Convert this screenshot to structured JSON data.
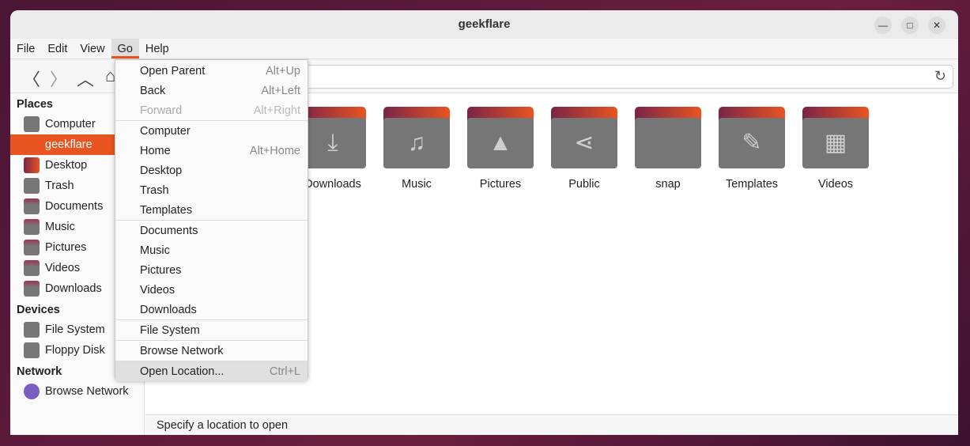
{
  "window": {
    "title": "geekflare"
  },
  "menubar": [
    "File",
    "Edit",
    "View",
    "Go",
    "Help"
  ],
  "go_menu": [
    [
      {
        "label": "Open Parent",
        "key": "Alt+Up"
      },
      {
        "label": "Back",
        "key": "Alt+Left"
      },
      {
        "label": "Forward",
        "key": "Alt+Right",
        "disabled": true
      }
    ],
    [
      {
        "label": "Computer",
        "key": ""
      },
      {
        "label": "Home",
        "key": "Alt+Home"
      },
      {
        "label": "Desktop",
        "key": ""
      },
      {
        "label": "Trash",
        "key": ""
      },
      {
        "label": "Templates",
        "key": ""
      }
    ],
    [
      {
        "label": "Documents",
        "key": ""
      },
      {
        "label": "Music",
        "key": ""
      },
      {
        "label": "Pictures",
        "key": ""
      },
      {
        "label": "Videos",
        "key": ""
      },
      {
        "label": "Downloads",
        "key": ""
      }
    ],
    [
      {
        "label": "File System",
        "key": ""
      }
    ],
    [
      {
        "label": "Browse Network",
        "key": ""
      }
    ],
    [
      {
        "label": "Open Location...",
        "key": "Ctrl+L",
        "highlighted": true
      }
    ]
  ],
  "sidebar": [
    {
      "header": "Places",
      "items": [
        {
          "label": "Computer",
          "icon": "computer"
        },
        {
          "label": "geekflare",
          "icon": "home",
          "selected": true
        },
        {
          "label": "Desktop",
          "icon": "desktop"
        },
        {
          "label": "Trash",
          "icon": "trash"
        },
        {
          "label": "Documents",
          "icon": "folder-documents"
        },
        {
          "label": "Music",
          "icon": "folder-music"
        },
        {
          "label": "Pictures",
          "icon": "folder-pictures"
        },
        {
          "label": "Videos",
          "icon": "folder-videos"
        },
        {
          "label": "Downloads",
          "icon": "folder-downloads"
        }
      ]
    },
    {
      "header": "Devices",
      "items": [
        {
          "label": "File System",
          "icon": "drive"
        },
        {
          "label": "Floppy Disk",
          "icon": "floppy"
        }
      ]
    },
    {
      "header": "Network",
      "items": [
        {
          "label": "Browse Network",
          "icon": "network"
        }
      ]
    }
  ],
  "folders": [
    {
      "label": "Downloads",
      "glyph": "⤓"
    },
    {
      "label": "Music",
      "glyph": "♫"
    },
    {
      "label": "Pictures",
      "glyph": "▲"
    },
    {
      "label": "Public",
      "glyph": "⋖"
    },
    {
      "label": "snap",
      "glyph": ""
    },
    {
      "label": "Templates",
      "glyph": "✎"
    },
    {
      "label": "Videos",
      "glyph": "▦"
    }
  ],
  "status": "Specify a location to open",
  "colors": {
    "accent": "#e95420"
  }
}
